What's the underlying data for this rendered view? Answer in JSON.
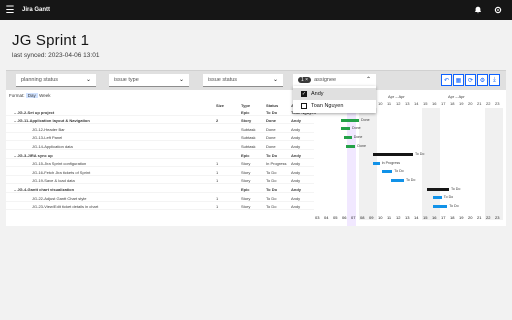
{
  "app": {
    "title": "Jira Gantt"
  },
  "page": {
    "title": "JG Sprint 1",
    "last_synced": "last synced: 2023-04-06 13:01"
  },
  "filters": {
    "planning_status": "planning status",
    "issue_type": "issue type",
    "issue_status": "issue status",
    "assignee_count": "1",
    "assignee_clear": "×",
    "assignee": "assignee"
  },
  "assignee_menu": {
    "items": [
      {
        "label": "Andy",
        "checked": true
      },
      {
        "label": "Toan Nguyen",
        "checked": false
      }
    ]
  },
  "format": {
    "label": "Format:",
    "day": "Day",
    "week": "Week"
  },
  "columns": {
    "size": "Size",
    "type": "Type",
    "status": "Status",
    "assignee": "Assignee"
  },
  "rows": [
    {
      "name": "– JG-2-Set up project",
      "size": "",
      "type": "Epic",
      "status": "To Do",
      "assignee": "Toan Nguyen",
      "parent": true
    },
    {
      "name": "– JG-11-Application layout & Navigation",
      "size": "2",
      "type": "Story",
      "status": "Done",
      "assignee": "Andy",
      "parent": true
    },
    {
      "name": "JG-12-Header Bar",
      "size": "",
      "type": "Subtask",
      "status": "Done",
      "assignee": "Andy",
      "parent": false
    },
    {
      "name": "JG-13-Left Panel",
      "size": "",
      "type": "Subtask",
      "status": "Done",
      "assignee": "Andy",
      "parent": false
    },
    {
      "name": "JG-14-Application data",
      "size": "",
      "type": "Subtask",
      "status": "Done",
      "assignee": "Andy",
      "parent": false
    },
    {
      "name": "– JG-3-JIRA sync up",
      "size": "",
      "type": "Epic",
      "status": "To Do",
      "assignee": "Andy",
      "parent": true
    },
    {
      "name": "JG-15-Jira Sprint configuration",
      "size": "1",
      "type": "Story",
      "status": "In Progress",
      "assignee": "Andy",
      "parent": false
    },
    {
      "name": "JG-16-Fetch Jira tickets of Sprint",
      "size": "1",
      "type": "Story",
      "status": "To Do",
      "assignee": "Andy",
      "parent": false
    },
    {
      "name": "JG-19-Save & load data",
      "size": "1",
      "type": "Story",
      "status": "To Do",
      "assignee": "Andy",
      "parent": false
    },
    {
      "name": "– JG-4-Gantt chart visualization",
      "size": "",
      "type": "Epic",
      "status": "To Do",
      "assignee": "Andy",
      "parent": true
    },
    {
      "name": "JG-22-Adjust Gantt Chart style",
      "size": "1",
      "type": "Story",
      "status": "To Do",
      "assignee": "Andy",
      "parent": false
    },
    {
      "name": "JG-23-View/Edit ticket details in chart",
      "size": "1",
      "type": "Story",
      "status": "To Do",
      "assignee": "Andy",
      "parent": false
    }
  ],
  "timeline": {
    "months": [
      "Apr – Apr",
      "Apr – Apr"
    ],
    "days": [
      "03",
      "04",
      "05",
      "06",
      "07",
      "08",
      "09",
      "10",
      "11",
      "12",
      "13",
      "14",
      "15",
      "16",
      "17",
      "18",
      "19",
      "20",
      "21",
      "22",
      "23"
    ],
    "bar_labels": [
      "To Do",
      "Done",
      "Done",
      "Done",
      "Done",
      "To Do",
      "In Progress",
      "To Do",
      "To Do",
      "To Do",
      "To Do",
      "To Do"
    ]
  },
  "colors": {
    "done": "#24a148",
    "in_progress": "#1192e8",
    "summary": "#161616",
    "today": "#8a3ffc"
  }
}
